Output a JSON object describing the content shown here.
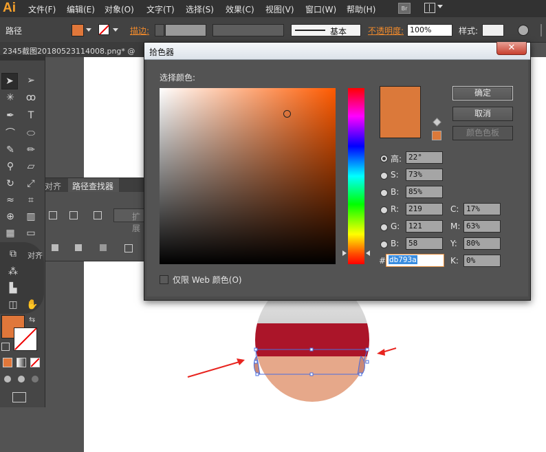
{
  "app": {
    "logo": "Ai"
  },
  "menu": {
    "items": [
      "文件(F)",
      "编辑(E)",
      "对象(O)",
      "文字(T)",
      "选择(S)",
      "效果(C)",
      "视图(V)",
      "窗口(W)",
      "帮助(H)"
    ],
    "bridge_label": "Br"
  },
  "control_bar": {
    "selection_label": "路径",
    "stroke_label": "描边:",
    "brush_label": "基本",
    "opacity_label": "不透明度:",
    "opacity_value": "100%",
    "style_label": "样式:",
    "fill_color": "#e0773a"
  },
  "document": {
    "tab_title": "2345截图20180523114008.png* @"
  },
  "panels": {
    "pathfinder": {
      "tab_align": "对齐",
      "tab_pathfinder": "路径查找器",
      "expand_label": "扩展"
    },
    "align_flyout": "对齐"
  },
  "color_picker": {
    "title": "拾色器",
    "select_color_label": "选择颜色:",
    "ok_label": "确定",
    "cancel_label": "取消",
    "swatches_label": "颜色色板",
    "color_hex": "#db793a",
    "hsb": {
      "h_label": "高:",
      "h": "22°",
      "s_label": "S:",
      "s": "73%",
      "b_label": "B:",
      "b": "85%"
    },
    "rgb": {
      "r_label": "R:",
      "r": "219",
      "g_label": "G:",
      "g": "121",
      "b_label": "B:",
      "b": "58"
    },
    "cmyk": {
      "c_label": "C:",
      "c": "17%",
      "m_label": "M:",
      "m": "63%",
      "y_label": "Y:",
      "y": "80%",
      "k_label": "K:",
      "k": "0%"
    },
    "hex_label": "#",
    "hex_value": "db793a",
    "web_only_label": "仅限 Web 颜色(O)"
  },
  "artwork": {
    "cap_color": "#ab1529",
    "face_color": "#e6a88a",
    "highlight_color": "#d9d9d9",
    "arrow_color": "#e8241f"
  }
}
